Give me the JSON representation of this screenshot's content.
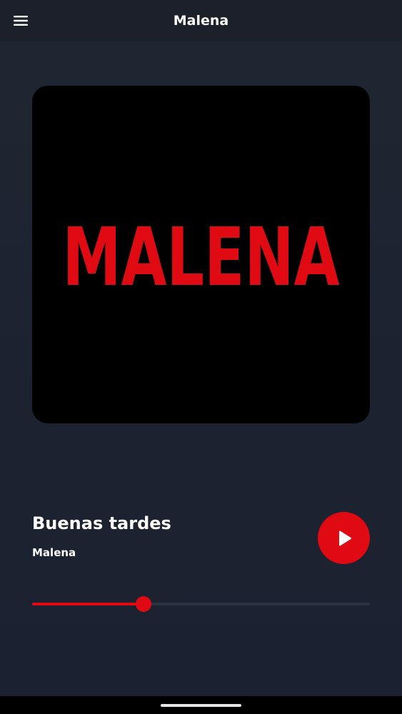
{
  "app": {
    "title": "Malena"
  },
  "header": {
    "menu_icon": "hamburger-menu-icon"
  },
  "artwork": {
    "logo_text": "MALENA",
    "background": "#000000",
    "logo_color": "#e00a12"
  },
  "player": {
    "track_title": "Buenas tardes",
    "artist": "Malena",
    "play_icon": "play-icon",
    "progress": 0.33
  },
  "colors": {
    "accent": "#e00a12",
    "background": "#1c2230",
    "appbar": "#1b202a",
    "text": "#ffffff"
  }
}
